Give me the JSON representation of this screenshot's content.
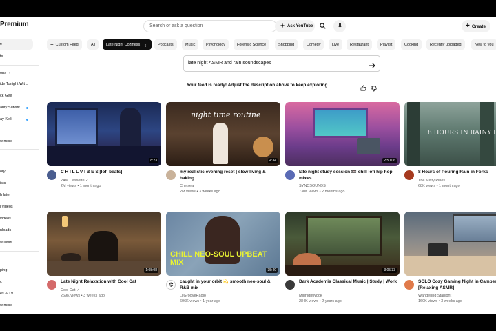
{
  "header": {
    "logo_text": "Premium",
    "search_placeholder": "Search or ask a question",
    "ask_label": "Ask YouTube",
    "create_label": "Create"
  },
  "sidebar": {
    "items": [
      {
        "label": "e"
      },
      {
        "label": "ts"
      },
      {
        "label": "ons"
      },
      {
        "label": "ide Tonight Wit..."
      },
      {
        "label": "ck Gee"
      },
      {
        "label": "arity Substit..."
      },
      {
        "label": "ay Kelli"
      },
      {
        "label": "w more"
      },
      {
        "label": "ory"
      },
      {
        "label": "ists"
      },
      {
        "label": "h later"
      },
      {
        "label": "l videos"
      },
      {
        "label": "videos"
      },
      {
        "label": "nloads"
      },
      {
        "label": "w more"
      },
      {
        "label": "ping"
      },
      {
        "label": "c"
      },
      {
        "label": "es & TV"
      },
      {
        "label": "w more"
      }
    ]
  },
  "chips": [
    {
      "label": "Custom Feed"
    },
    {
      "label": "All"
    },
    {
      "label": "Late Night Coziness"
    },
    {
      "label": "Podcasts"
    },
    {
      "label": "Music"
    },
    {
      "label": "Psychology"
    },
    {
      "label": "Forensic Science"
    },
    {
      "label": "Shopping"
    },
    {
      "label": "Comedy"
    },
    {
      "label": "Live"
    },
    {
      "label": "Restaurant"
    },
    {
      "label": "Playlist"
    },
    {
      "label": "Cooking"
    },
    {
      "label": "Recently uploaded"
    },
    {
      "label": "New to you"
    }
  ],
  "prompt": {
    "text": "late night ASMR and rain soundscapes",
    "ready_message": "Your feed is ready! Adjust the description above to keep exploring"
  },
  "videos": [
    {
      "title": "C H I L L  V I B E S [lofi beats]",
      "channel": "2AM Cassette",
      "stats": "2M views • 1 month ago",
      "duration": "8:23",
      "thumb_text": ""
    },
    {
      "title": "my realistic evening reset | slow living & baking",
      "channel": "Chelsea",
      "stats": "2M views • 3 weeks ago",
      "duration": "4:34",
      "thumb_text": "night time routine"
    },
    {
      "title": "late night study session 📼 chill lofi hip hop mixes",
      "channel": "SYNCSOUNDS",
      "stats": "730K views • 2 months ago",
      "duration": "2:50:06",
      "thumb_text": ""
    },
    {
      "title": "8 Hours of Pouring Rain in Forks",
      "channel": "The Misty Pines",
      "stats": "68K views • 1 month ago",
      "duration": "",
      "thumb_text": "8 HOURS IN RAINY FORKS"
    },
    {
      "title": "Late Night Relaxation with Cool Cat",
      "channel": "Cool Cat",
      "stats": "269K views • 3 weeks ago",
      "duration": "1:08:08",
      "thumb_text": ""
    },
    {
      "title": "caught in your orbit 💫 smooth neo-soul & R&B mix",
      "channel": "LilGrooveRadio",
      "stats": "606K views • 1 year ago",
      "duration": "35:40",
      "thumb_text": "CHILL NEO-SOUL UPBEAT MIX"
    },
    {
      "title": "Dark Academia Classical Music | Study | Work",
      "channel": "MidnightNook",
      "stats": "284K views • 2 years ago",
      "duration": "3:05:33",
      "thumb_text": ""
    },
    {
      "title": "SOLO Cozy Gaming Night in Camper D Storm [Relaxing ASMR]",
      "channel": "Wandering Starlight",
      "stats": "160K views • 3 weeks ago",
      "duration": "",
      "thumb_text": ""
    }
  ]
}
